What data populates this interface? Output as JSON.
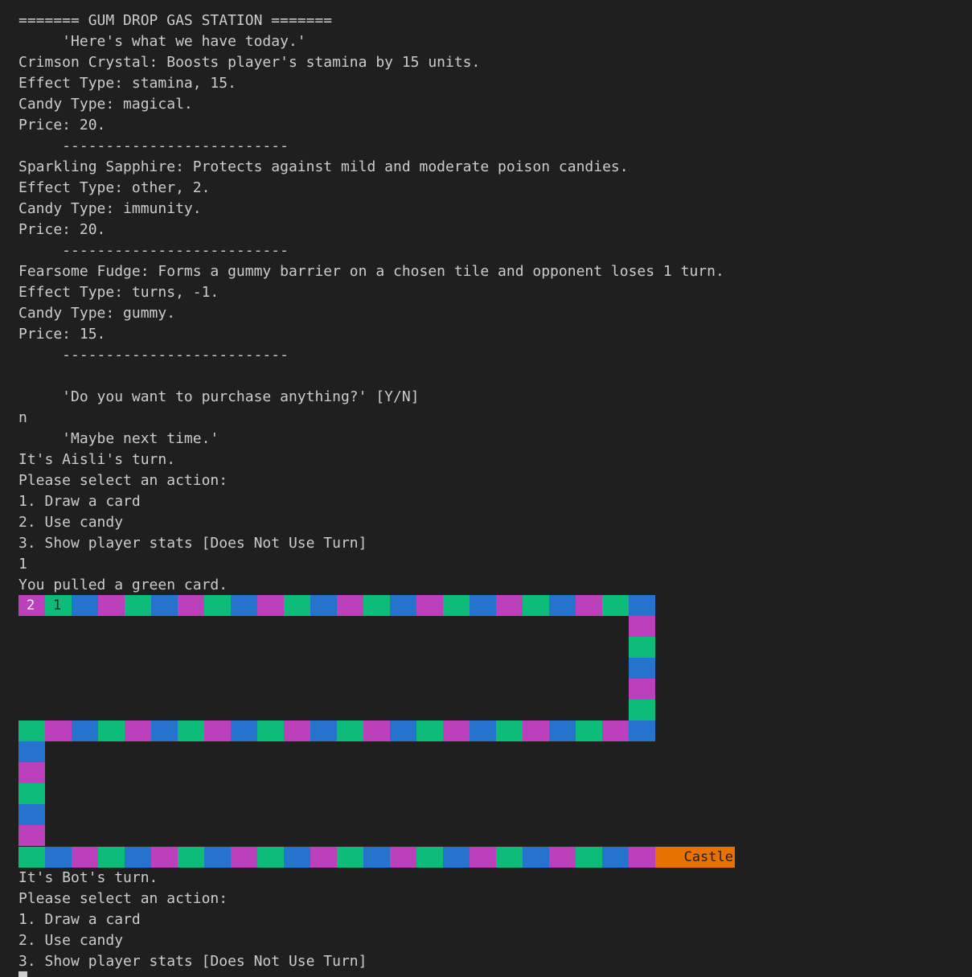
{
  "colors": {
    "background": "#1f1f1f",
    "text": "#cccccc",
    "blue": "#2573cc",
    "magenta": "#bc3fbc",
    "green": "#0dbc79",
    "orange": "#e87200"
  },
  "top_lines": [
    "======= GUM DROP GAS STATION =======",
    "     'Here's what we have today.'",
    "Crimson Crystal: Boosts player's stamina by 15 units.",
    "Effect Type: stamina, 15.",
    "Candy Type: magical.",
    "Price: 20.",
    "     --------------------------",
    "Sparkling Sapphire: Protects against mild and moderate poison candies.",
    "Effect Type: other, 2.",
    "Candy Type: immunity.",
    "Price: 20.",
    "     --------------------------",
    "Fearsome Fudge: Forms a gummy barrier on a chosen tile and opponent loses 1 turn.",
    "Effect Type: turns, -1.",
    "Candy Type: gummy.",
    "Price: 15.",
    "     --------------------------",
    "",
    "     'Do you want to purchase anything?' [Y/N]",
    "n",
    "     'Maybe next time.'",
    "It's Aisli's turn.",
    "Please select an action:",
    "1. Draw a card",
    "2. Use candy",
    "3. Show player stats [Does Not Use Turn]",
    "1",
    "You pulled a green card."
  ],
  "bottom_lines": [
    "It's Bot's turn.",
    "Please select an action:",
    "1. Draw a card",
    "2. Use candy",
    "3. Show player stats [Does Not Use Turn]"
  ],
  "board": {
    "player_markers": [
      "2",
      "1"
    ],
    "castle_label": "Castle",
    "row1_colors": [
      "magenta",
      "green",
      "blue",
      "magenta",
      "green",
      "blue",
      "magenta",
      "green",
      "blue",
      "magenta",
      "green",
      "blue",
      "magenta",
      "green",
      "blue",
      "magenta",
      "green",
      "blue",
      "magenta",
      "green",
      "blue",
      "magenta",
      "green",
      "blue"
    ],
    "col1_colors": [
      "magenta",
      "green",
      "blue",
      "magenta",
      "green"
    ],
    "row2_colors": [
      "green",
      "magenta",
      "blue",
      "green",
      "magenta",
      "blue",
      "green",
      "magenta",
      "blue",
      "green",
      "magenta",
      "blue",
      "green",
      "magenta",
      "blue",
      "green",
      "magenta",
      "blue",
      "green",
      "magenta",
      "blue",
      "green",
      "magenta",
      "blue"
    ],
    "col2_colors": [
      "blue",
      "magenta",
      "green",
      "blue",
      "magenta"
    ],
    "row3_colors": [
      "green",
      "blue",
      "magenta",
      "green",
      "blue",
      "magenta",
      "green",
      "blue",
      "magenta",
      "green",
      "blue",
      "magenta",
      "green",
      "blue",
      "magenta",
      "green",
      "blue",
      "magenta",
      "green",
      "blue",
      "magenta",
      "green",
      "blue",
      "magenta",
      "orange"
    ]
  }
}
